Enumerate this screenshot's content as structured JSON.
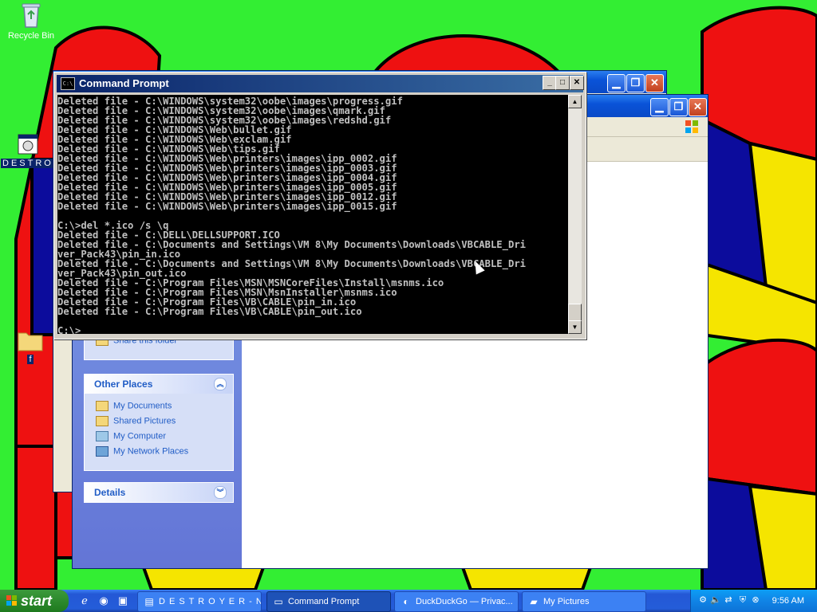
{
  "desktop": {
    "icons": [
      {
        "label": "Recycle Bin"
      },
      {
        "label": "DESTROYER"
      },
      {
        "label": "f"
      }
    ]
  },
  "explorer": {
    "task_pane": {
      "file_tasks": {
        "share_link": "Share this folder"
      },
      "other_places": {
        "title": "Other Places",
        "links": [
          "My Documents",
          "Shared Pictures",
          "My Computer",
          "My Network Places"
        ]
      },
      "details": {
        "title": "Details"
      }
    }
  },
  "cmd": {
    "title": "Command Prompt",
    "icon_text": "C:\\",
    "lines": [
      "Deleted file - C:\\WINDOWS\\system32\\oobe\\images\\progress.gif",
      "Deleted file - C:\\WINDOWS\\system32\\oobe\\images\\qmark.gif",
      "Deleted file - C:\\WINDOWS\\system32\\oobe\\images\\redshd.gif",
      "Deleted file - C:\\WINDOWS\\Web\\bullet.gif",
      "Deleted file - C:\\WINDOWS\\Web\\exclam.gif",
      "Deleted file - C:\\WINDOWS\\Web\\tips.gif",
      "Deleted file - C:\\WINDOWS\\Web\\printers\\images\\ipp_0002.gif",
      "Deleted file - C:\\WINDOWS\\Web\\printers\\images\\ipp_0003.gif",
      "Deleted file - C:\\WINDOWS\\Web\\printers\\images\\ipp_0004.gif",
      "Deleted file - C:\\WINDOWS\\Web\\printers\\images\\ipp_0005.gif",
      "Deleted file - C:\\WINDOWS\\Web\\printers\\images\\ipp_0012.gif",
      "Deleted file - C:\\WINDOWS\\Web\\printers\\images\\ipp_0015.gif",
      "",
      "C:\\>del *.ico /s \\q",
      "Deleted file - C:\\DELL\\DELLSUPPORT.ICO",
      "Deleted file - C:\\Documents and Settings\\VM 8\\My Documents\\Downloads\\VBCABLE_Dri",
      "ver_Pack43\\pin_in.ico",
      "Deleted file - C:\\Documents and Settings\\VM 8\\My Documents\\Downloads\\VBCABLE_Dri",
      "ver_Pack43\\pin_out.ico",
      "Deleted file - C:\\Program Files\\MSN\\MSNCoreFiles\\Install\\msnms.ico",
      "Deleted file - C:\\Program Files\\MSN\\MsnInstaller\\msnms.ico",
      "Deleted file - C:\\Program Files\\VB\\CABLE\\pin_in.ico",
      "Deleted file - C:\\Program Files\\VB\\CABLE\\pin_out.ico",
      "",
      "C:\\>_"
    ]
  },
  "taskbar": {
    "start_label": "start",
    "tasks": [
      {
        "label": "D E S T R O Y E R - N...",
        "icon": "notepad-icon"
      },
      {
        "label": "Command Prompt",
        "icon": "cmd-icon"
      },
      {
        "label": "DuckDuckGo — Privac...",
        "icon": "duck-icon"
      },
      {
        "label": "My Pictures",
        "icon": "folder-icon"
      }
    ],
    "clock": "9:56 AM"
  }
}
